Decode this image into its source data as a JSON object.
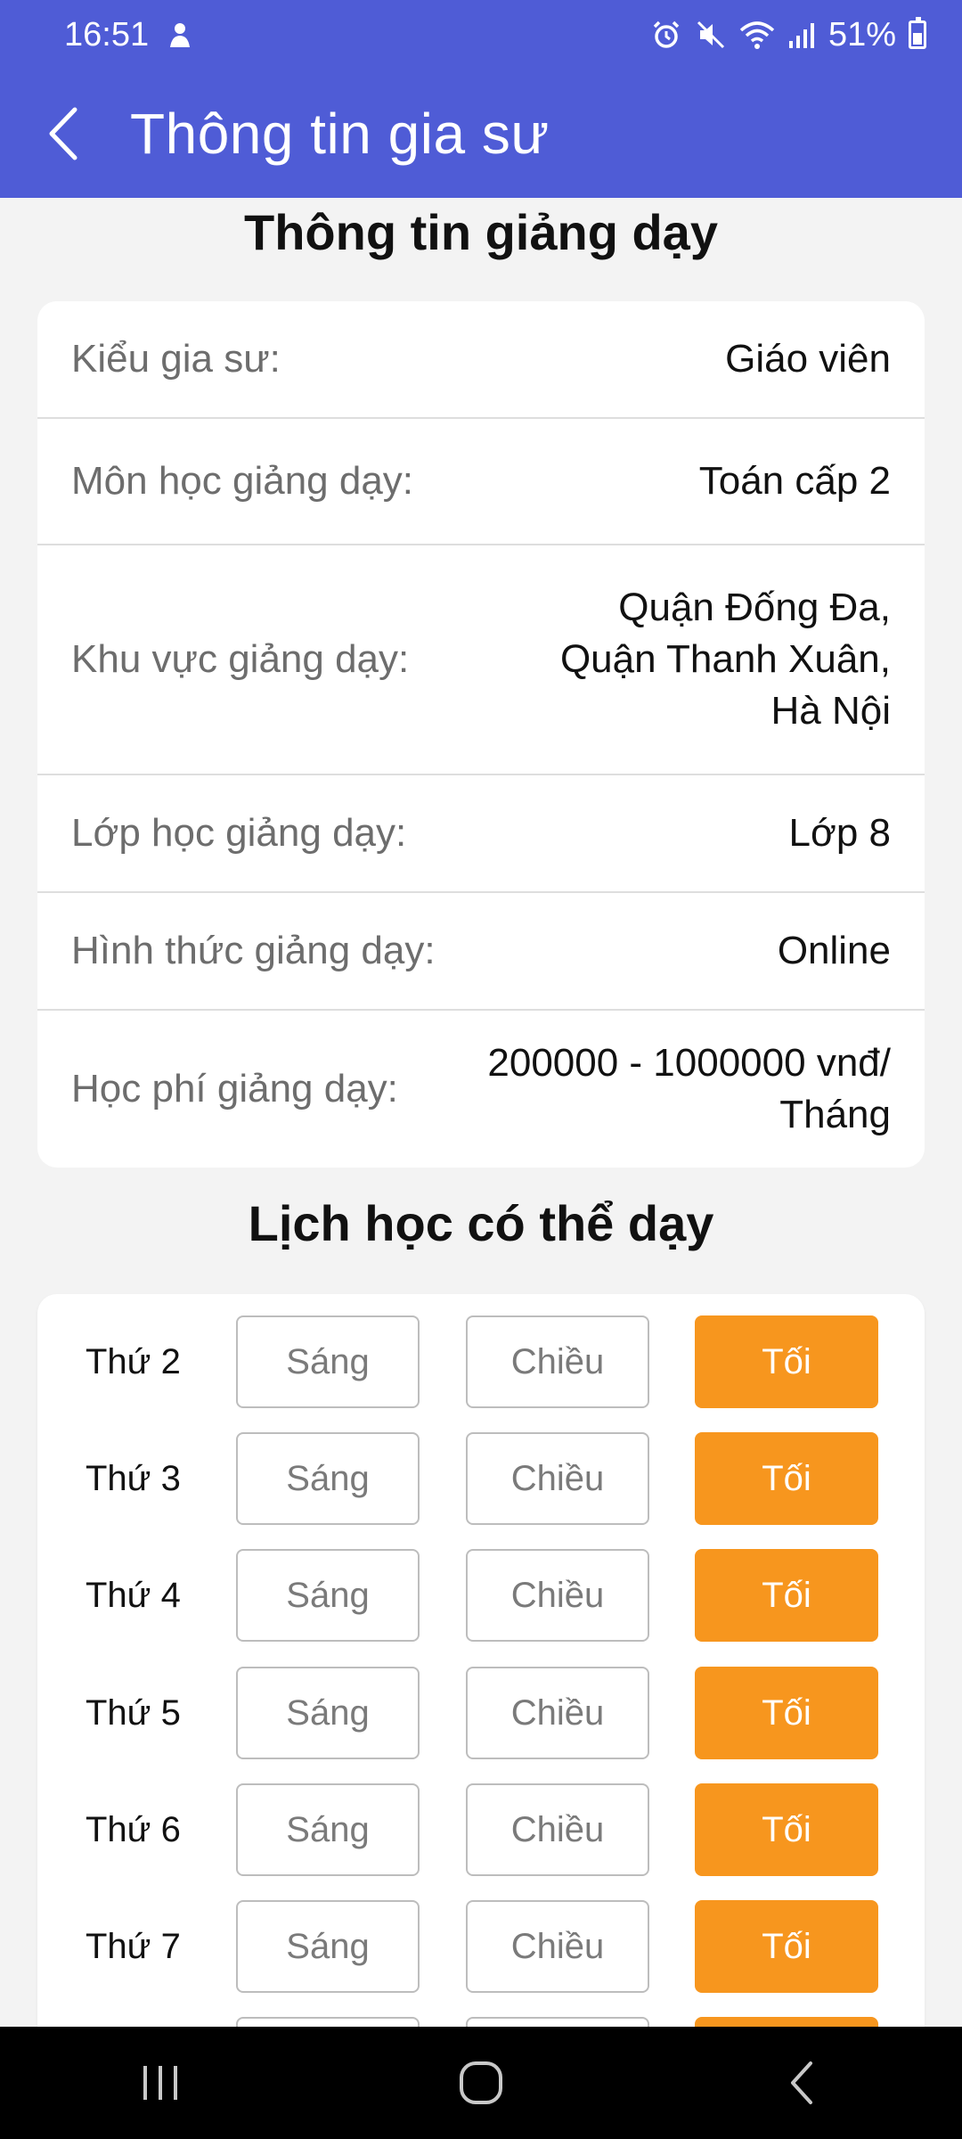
{
  "status_bar": {
    "time": "16:51",
    "battery": "51%"
  },
  "header": {
    "title": "Thông tin gia sư"
  },
  "teaching_info": {
    "section_title": "Thông tin giảng dạy",
    "rows": [
      {
        "label": "Kiểu gia sư:",
        "value": [
          "Giáo viên"
        ]
      },
      {
        "label": "Môn học giảng dạy:",
        "value": [
          "Toán cấp 2"
        ]
      },
      {
        "label": "Khu vực giảng dạy:",
        "value": [
          "Quận Đống Đa,",
          "Quận Thanh Xuân,",
          "Hà Nội"
        ]
      },
      {
        "label": "Lớp học giảng dạy:",
        "value": [
          "Lớp 8"
        ]
      },
      {
        "label": "Hình thức giảng dạy:",
        "value": [
          "Online"
        ]
      },
      {
        "label": "Học phí giảng dạy:",
        "value": [
          "200000 - 1000000 vnđ/",
          "Tháng"
        ]
      }
    ]
  },
  "schedule": {
    "section_title": "Lịch học có thể dạy",
    "slot_labels": {
      "morning": "Sáng",
      "afternoon": "Chiều",
      "evening": "Tối"
    },
    "active_color": "#f7961e",
    "days": [
      {
        "day": "Thứ 2",
        "morning": false,
        "afternoon": false,
        "evening": true
      },
      {
        "day": "Thứ 3",
        "morning": false,
        "afternoon": false,
        "evening": true
      },
      {
        "day": "Thứ 4",
        "morning": false,
        "afternoon": false,
        "evening": true
      },
      {
        "day": "Thứ 5",
        "morning": false,
        "afternoon": false,
        "evening": true
      },
      {
        "day": "Thứ 6",
        "morning": false,
        "afternoon": false,
        "evening": true
      },
      {
        "day": "Thứ 7",
        "morning": false,
        "afternoon": false,
        "evening": true
      },
      {
        "day": "",
        "morning": false,
        "afternoon": false,
        "evening": true
      }
    ]
  },
  "colors": {
    "app_bar": "#4f5cd6",
    "accent": "#f7961e"
  },
  "icons": {
    "back": "back-arrow-icon",
    "recent_apps": "recent-apps-icon",
    "home": "home-icon",
    "nav_back": "nav-back-icon"
  }
}
